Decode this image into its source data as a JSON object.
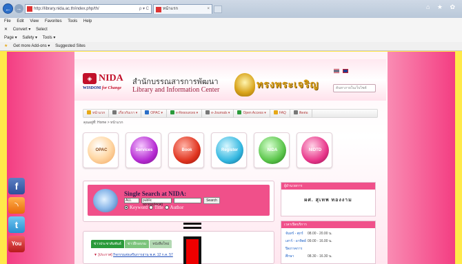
{
  "browser": {
    "address": "http://library.nida.ac.th/index.php/th/",
    "address_tools": "ρ ▾ C",
    "tab_title": "หน้าแรก",
    "menu": [
      "File",
      "Edit",
      "View",
      "Favorites",
      "Tools",
      "Help"
    ],
    "cmd1": [
      "✕",
      "Convert ▾",
      "Select"
    ],
    "cmd2": [
      "Page ▾",
      "Safety ▾",
      "Tools ▾"
    ],
    "favorites": [
      "Get more Add-ons ▾",
      "Suggested Sites"
    ],
    "win_icons": "⌂ ★ ✿"
  },
  "header": {
    "logo_abbr": "NIDA",
    "logo_tagline_1": "WISDOM",
    "logo_tagline_2": "for Change",
    "thai_title": "สำนักบรรณสารการพัฒนา",
    "eng_title": "Library and Information Center",
    "banner_text": "ทรงพระเจริญ",
    "search_placeholder": "ค้นหาภายในเว็บไซต์"
  },
  "nav": {
    "items": [
      {
        "label": "หน้าแรก",
        "color": "#e6a817"
      },
      {
        "label": "เกี่ยวกับเรา ▾",
        "color": "#777777"
      },
      {
        "label": "OPAC ▾",
        "color": "#2a6ec7"
      },
      {
        "label": "e-Resources ▾",
        "color": "#2a9a3a"
      },
      {
        "label": "e-Journals ▾",
        "color": "#777777"
      },
      {
        "label": "Open Access ▾",
        "color": "#2a9a3a"
      },
      {
        "label": "FAQ",
        "color": "#e6a817"
      },
      {
        "label": "ติดต่อ",
        "color": "#777777"
      }
    ],
    "breadcrumb": "คุณอยู่ที่: Home > หน้าแรก"
  },
  "icons": [
    {
      "label": "OPAC",
      "style": "ball-opac"
    },
    {
      "label": "Services",
      "style": "ball-purple"
    },
    {
      "label": "Book",
      "style": "ball-red"
    },
    {
      "label": "Register",
      "style": "ball-cyan"
    },
    {
      "label": "NIDA",
      "style": "ball-green"
    },
    {
      "label": "NIDTD",
      "style": "ball-pink"
    }
  ],
  "search": {
    "title": "Single Search at NIDA:",
    "field_value": "ALL",
    "scope_value": "public access(local)",
    "button": "Search",
    "options": [
      "Keyword",
      "Title",
      "Author"
    ],
    "selected": "Keyword"
  },
  "director": {
    "heading": "ผู้อำนวยการ",
    "name": "ผศ. สุเทพ ทองงาม"
  },
  "hours": {
    "heading": "เวลาเปิดบริการ",
    "rows": [
      {
        "label": "จันทร์ - ศุกร์",
        "time": "08.00 - 20.00 น."
      },
      {
        "label": "เสาร์ - อาทิตย์",
        "time": "09.00 - 16.00 น."
      },
      {
        "label": "ปิดภาคการศึกษา",
        "time": "08.30 - 16.30 น."
      }
    ]
  },
  "news": {
    "tabs": [
      "ข่าวประชาสัมพันธ์",
      "ข่าวฝึกอบรม",
      "หนังสือใหม่"
    ],
    "line_prefix": "▼ [ประกาศ]",
    "line_link": "กิจกรรมส่งเสริมการอ่าน พ.ศ. 12 ก.ค. 57"
  },
  "social": [
    "f",
    "◝",
    "t",
    "You"
  ]
}
